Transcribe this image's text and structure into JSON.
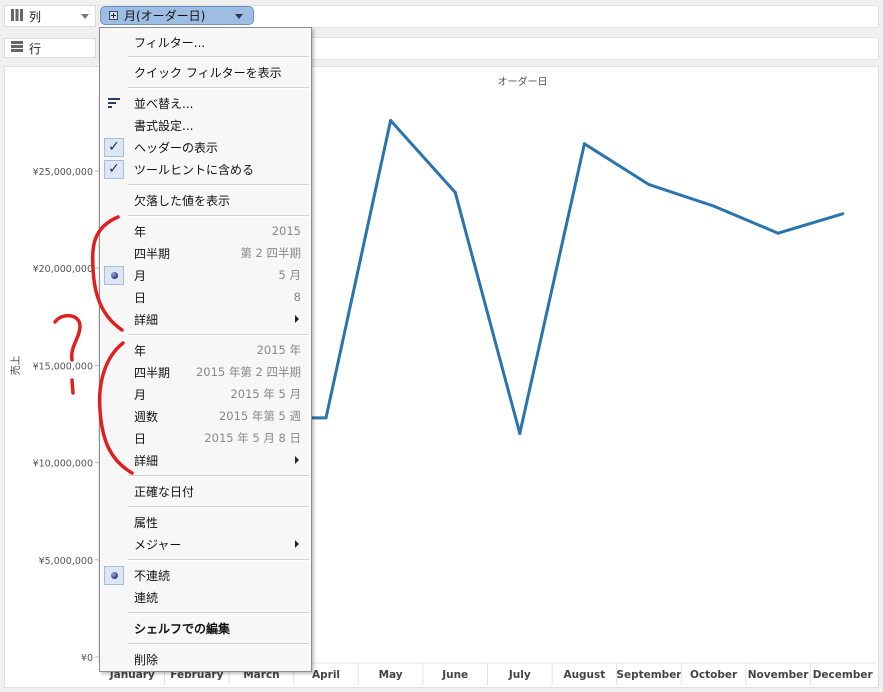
{
  "shelves": {
    "columns_label": "列",
    "rows_label": "行",
    "columns_pill": "月(オーダー日)"
  },
  "menu": {
    "filter": "フィルター...",
    "quick_filter": "クイック フィルターを表示",
    "sort": "並べ替え...",
    "format": "書式設定...",
    "show_header": "ヘッダーの表示",
    "include_tooltip": "ツールヒントに含める",
    "show_missing": "欠落した値を表示",
    "date_part": [
      {
        "label": "年",
        "value": "2015"
      },
      {
        "label": "四半期",
        "value": "第 2 四半期"
      },
      {
        "label": "月",
        "value": "5 月"
      },
      {
        "label": "日",
        "value": "8"
      },
      {
        "label": "詳細",
        "value": ""
      }
    ],
    "date_value": [
      {
        "label": "年",
        "value": "2015 年"
      },
      {
        "label": "四半期",
        "value": "2015 年第 2 四半期"
      },
      {
        "label": "月",
        "value": "2015 年 5 月"
      },
      {
        "label": "週数",
        "value": "2015 年第 5 週"
      },
      {
        "label": "日",
        "value": "2015 年 5 月 8 日"
      },
      {
        "label": "詳細",
        "value": ""
      }
    ],
    "exact_date": "正確な日付",
    "attribute": "属性",
    "measure": "メジャー",
    "discrete": "不連続",
    "continuous": "連続",
    "edit_in_shelf": "シェルフでの編集",
    "remove": "削除",
    "icons": {
      "check": "check-icon",
      "radio": "radio-dot-icon",
      "sort": "sort-icon",
      "submenu": "submenu-arrow-icon"
    }
  },
  "annotation": {
    "text": "?",
    "color": "#e0201e"
  },
  "chart_data": {
    "type": "line",
    "title": "オーダー日",
    "xlabel": "",
    "ylabel": "売上",
    "categories": [
      "January",
      "February",
      "March",
      "April",
      "May",
      "June",
      "July",
      "August",
      "September",
      "October",
      "November",
      "December"
    ],
    "series": [
      {
        "values": [
          null,
          null,
          12300000,
          12300000,
          27600000,
          23900000,
          11500000,
          26400000,
          24300000,
          23200000,
          21800000,
          22800000
        ]
      }
    ],
    "ylim": [
      0,
      30000000
    ],
    "yticks": [
      "¥0",
      "¥5,000,000",
      "¥10,000,000",
      "¥15,000,000",
      "¥20,000,000",
      "¥25,000,000"
    ],
    "ytick_values": [
      0,
      5000000,
      10000000,
      15000000,
      20000000,
      25000000
    ],
    "color": "#2a74ae",
    "grid": false
  }
}
